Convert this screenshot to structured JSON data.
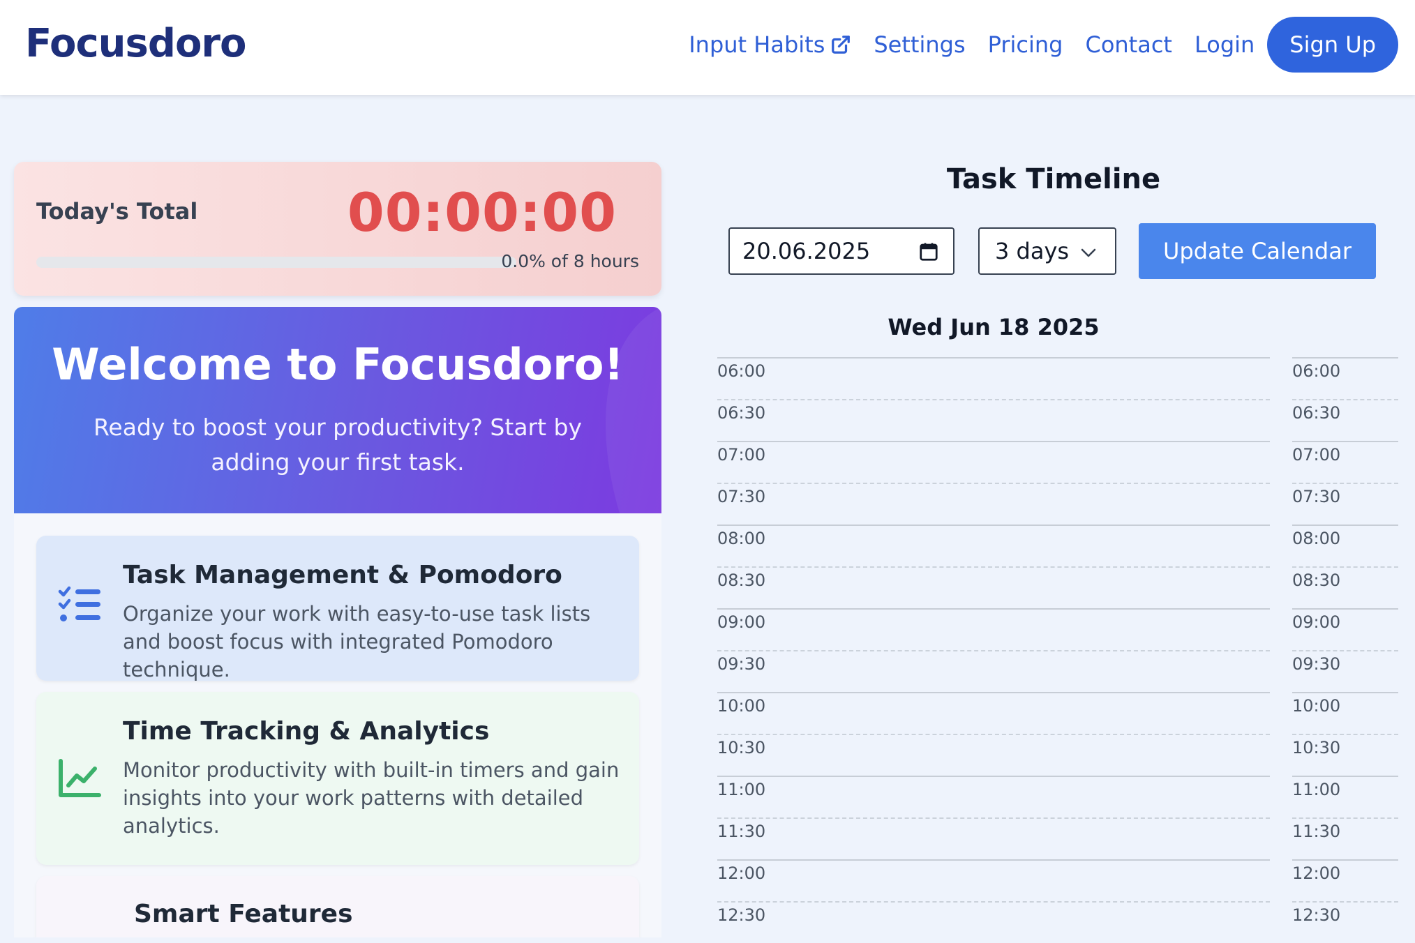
{
  "header": {
    "brand": "Focusdoro",
    "nav": {
      "input_habits": "Input Habits",
      "settings": "Settings",
      "pricing": "Pricing",
      "contact": "Contact",
      "login": "Login",
      "signup": "Sign Up"
    }
  },
  "today": {
    "label": "Today's Total",
    "time": "00:00:00",
    "progress_text": "0.0% of 8 hours",
    "progress_fraction": 0.0,
    "accent_color": "#e14e4e"
  },
  "welcome": {
    "title": "Welcome to Focusdoro!",
    "subtitle": "Ready to boost your productivity? Start by adding your first task."
  },
  "features": [
    {
      "icon": "checklist-icon",
      "title": "Task Management & Pomodoro",
      "description": "Organize your work with easy-to-use task lists and boost focus with integrated Pomodoro technique."
    },
    {
      "icon": "chart-line-icon",
      "title": "Time Tracking & Analytics",
      "description": "Monitor productivity with built-in timers and gain insights into your work patterns with detailed analytics."
    },
    {
      "title": "Smart Features"
    }
  ],
  "timeline": {
    "title": "Task Timeline",
    "date_value": "20.06.2025",
    "days_selected": "3 days",
    "update_button": "Update Calendar",
    "day_label": "Wed Jun 18 2025",
    "slots": [
      "06:00",
      "06:30",
      "07:00",
      "07:30",
      "08:00",
      "08:30",
      "09:00",
      "09:30",
      "10:00",
      "10:30",
      "11:00",
      "11:30",
      "12:00",
      "12:30"
    ]
  }
}
